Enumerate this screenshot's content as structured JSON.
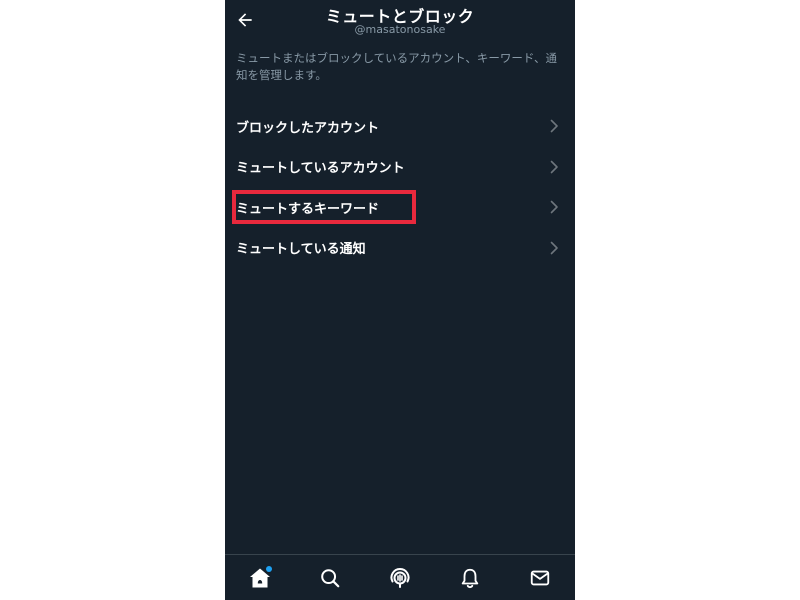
{
  "header": {
    "title": "ミュートとブロック",
    "subtitle": "@masatonosake",
    "back_icon": "arrow-left-icon"
  },
  "description": "ミュートまたはブロックしているアカウント、キーワード、通知を管理します。",
  "menu": {
    "items": [
      {
        "label": "ブロックしたアカウント",
        "icon": "chevron-right-icon"
      },
      {
        "label": "ミュートしているアカウント",
        "icon": "chevron-right-icon"
      },
      {
        "label": "ミュートするキーワード",
        "icon": "chevron-right-icon",
        "highlighted": true
      },
      {
        "label": "ミュートしている通知",
        "icon": "chevron-right-icon"
      }
    ]
  },
  "bottom_nav": {
    "items": [
      {
        "icon": "home-icon",
        "active": true,
        "badge": true
      },
      {
        "icon": "search-icon"
      },
      {
        "icon": "spaces-icon"
      },
      {
        "icon": "bell-icon"
      },
      {
        "icon": "mail-icon"
      }
    ]
  },
  "colors": {
    "background": "#15202b",
    "text_primary": "#ffffff",
    "text_secondary": "#8899a6",
    "divider": "#38444d",
    "highlight": "#e8293d",
    "accent": "#1da1f2"
  }
}
